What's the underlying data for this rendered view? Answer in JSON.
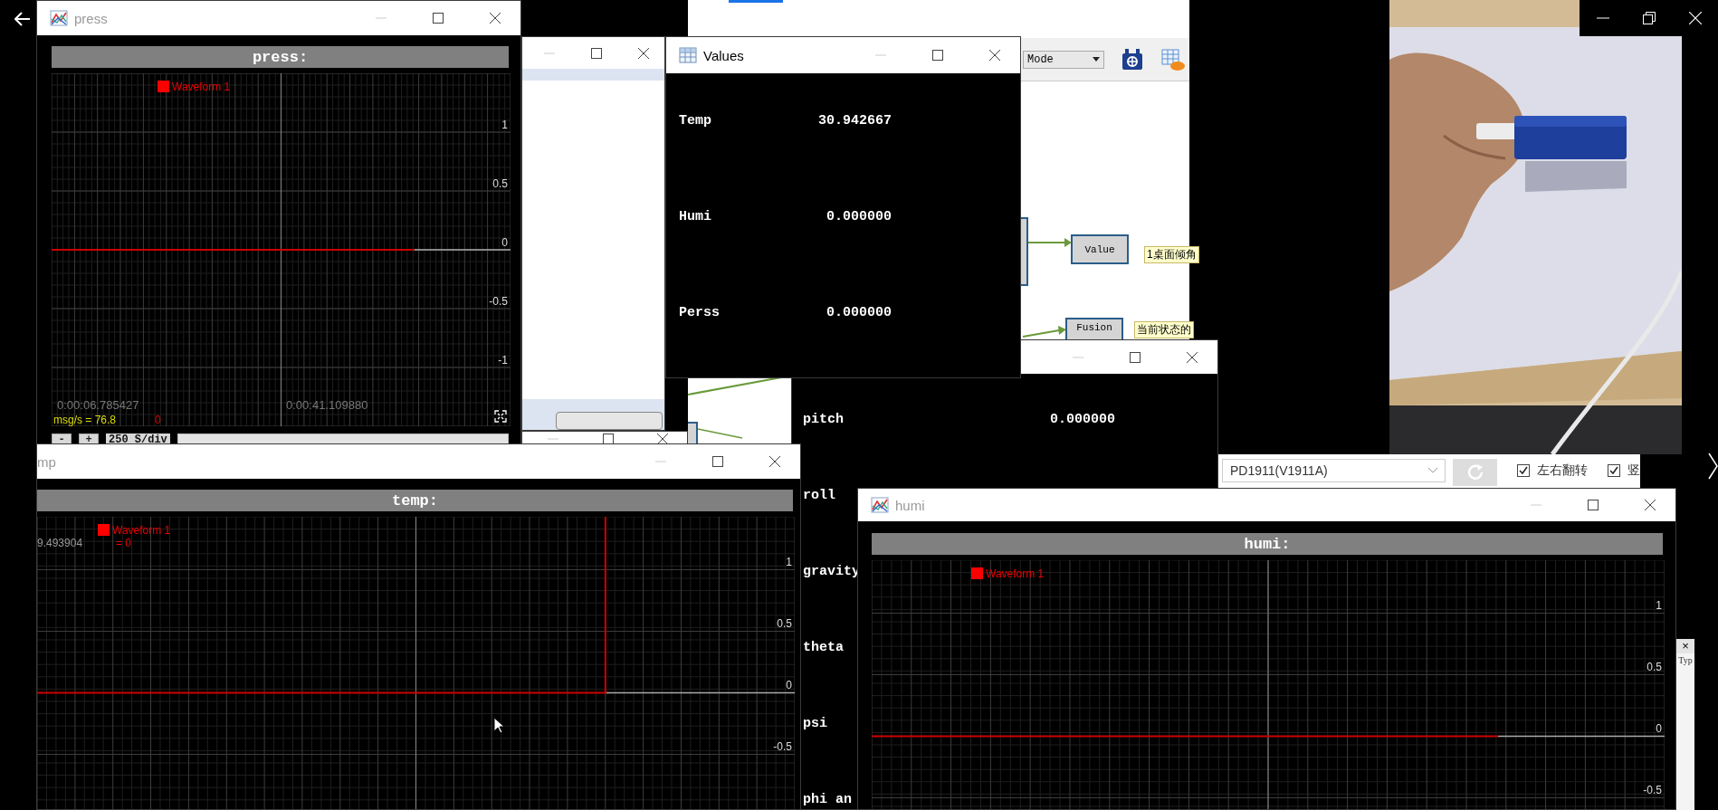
{
  "press_window": {
    "title": "press",
    "scope": {
      "header": "press:",
      "legend": "Waveform 1",
      "y_ticks": [
        "1",
        "0.5",
        "0",
        "-0.5",
        "-1"
      ],
      "time_start": "0:00:06.785427",
      "time_end": "0:00:41.109880",
      "rate": "msg/s = 76.8",
      "count": "0",
      "kind": "flat"
    },
    "controls": {
      "minus": "-",
      "plus": "+",
      "scale": "250 S/div"
    }
  },
  "flow_app": {
    "mode": "Mode",
    "nodes": [
      {
        "label": "Value"
      },
      {
        "label": "Fusion"
      }
    ],
    "notes": [
      "1桌面倾角",
      "当前状态的"
    ]
  },
  "values_window": {
    "title": "Values",
    "rows": [
      {
        "label": "Temp",
        "value": "30.942667"
      },
      {
        "label": "Humi",
        "value": "0.000000"
      },
      {
        "label": "Perss",
        "value": "0.000000"
      }
    ]
  },
  "orientation_window": {
    "rows": [
      {
        "label": "pitch",
        "value": "0.000000"
      },
      {
        "label": "roll"
      },
      {
        "label": "gravity"
      },
      {
        "label": "theta"
      },
      {
        "label": "psi"
      },
      {
        "label": "phi an"
      }
    ]
  },
  "mirror_panel": {
    "device": "PD1911(V1911A)",
    "options": [
      {
        "label": "左右翻转",
        "checked": true
      },
      {
        "label": "竖",
        "checked": true
      }
    ]
  },
  "side_panel": {
    "close": "×",
    "label": "Typ"
  },
  "temp_window": {
    "title": "mp",
    "scope": {
      "header": "temp:",
      "legend": "Waveform 1",
      "legend_value": "= 0",
      "cursor_time": "9.493904",
      "y_ticks": [
        "1",
        "0.5",
        "0",
        "-0.5"
      ],
      "kind": "step"
    }
  },
  "humi_window": {
    "title": "humi",
    "scope": {
      "header": "humi:",
      "legend": "Waveform 1",
      "y_ticks": [
        "1",
        "0.5",
        "0",
        "-0.5"
      ],
      "kind": "flat"
    }
  }
}
